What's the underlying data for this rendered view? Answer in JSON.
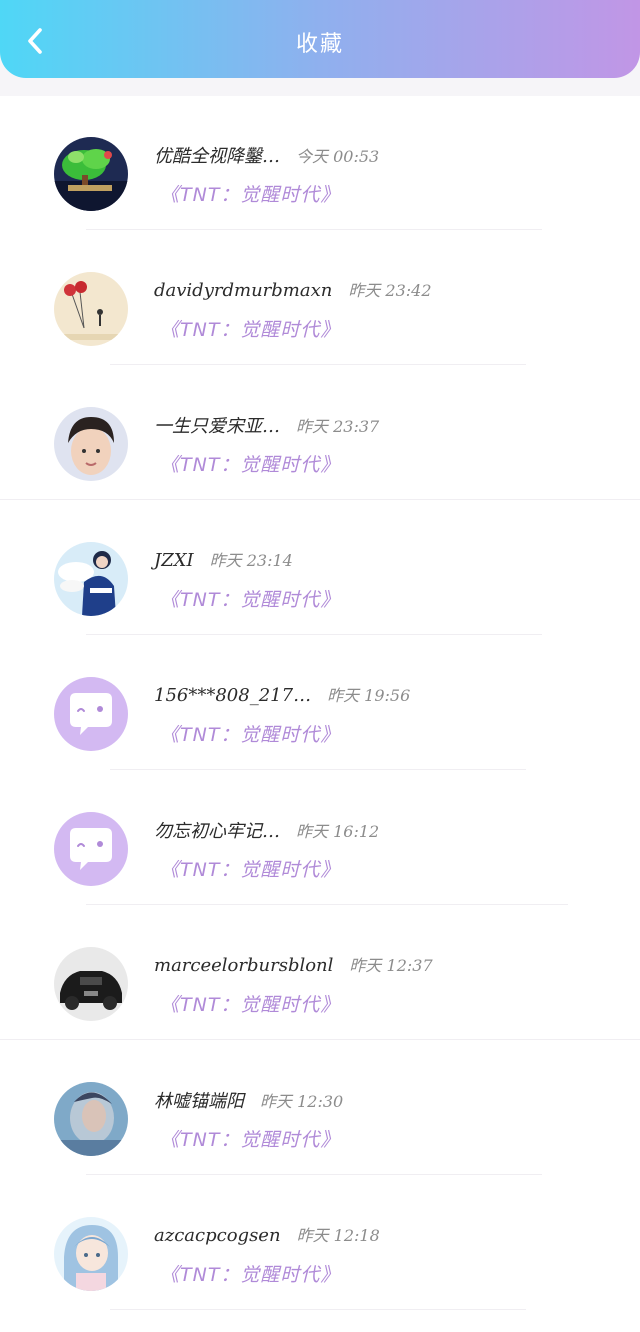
{
  "header": {
    "title": "收藏",
    "back_icon": "chevron-left-icon",
    "gradient": [
      "#4fd7f6",
      "#c196e6"
    ]
  },
  "accent_color": "#b08ad8",
  "items": [
    {
      "name": "优酷全视降鑿…",
      "time": "今天 00:53",
      "work": "《TNT：觉醒时代》",
      "avatar": "bonsai-photo"
    },
    {
      "name": "davidyrdmurbmaxn",
      "time": "昨天 23:42",
      "work": "《TNT：觉醒时代》",
      "avatar": "balloon-illustration"
    },
    {
      "name": "一生只爱宋亚…",
      "time": "昨天 23:37",
      "work": "《TNT：觉醒时代》",
      "avatar": "boy-portrait"
    },
    {
      "name": "JZXI",
      "time": "昨天 23:14",
      "work": "《TNT：觉醒时代》",
      "avatar": "snow-boy-photo"
    },
    {
      "name": "156***808_217…",
      "time": "昨天 19:56",
      "work": "《TNT：觉醒时代》",
      "avatar": "default-chat-avatar"
    },
    {
      "name": "勿忘初心牢记…",
      "time": "昨天 16:12",
      "work": "《TNT：觉醒时代》",
      "avatar": "default-chat-avatar"
    },
    {
      "name": "marceelorbursblonl",
      "time": "昨天 12:37",
      "work": "《TNT：觉醒时代》",
      "avatar": "black-car-photo"
    },
    {
      "name": "林嘘锚端阳",
      "time": "昨天 12:30",
      "work": "《TNT：觉醒时代》",
      "avatar": "blurred-portrait"
    },
    {
      "name": "azcacpcogsen",
      "time": "昨天 12:18",
      "work": "《TNT：觉醒时代》",
      "avatar": "anime-girl-illustration"
    }
  ]
}
